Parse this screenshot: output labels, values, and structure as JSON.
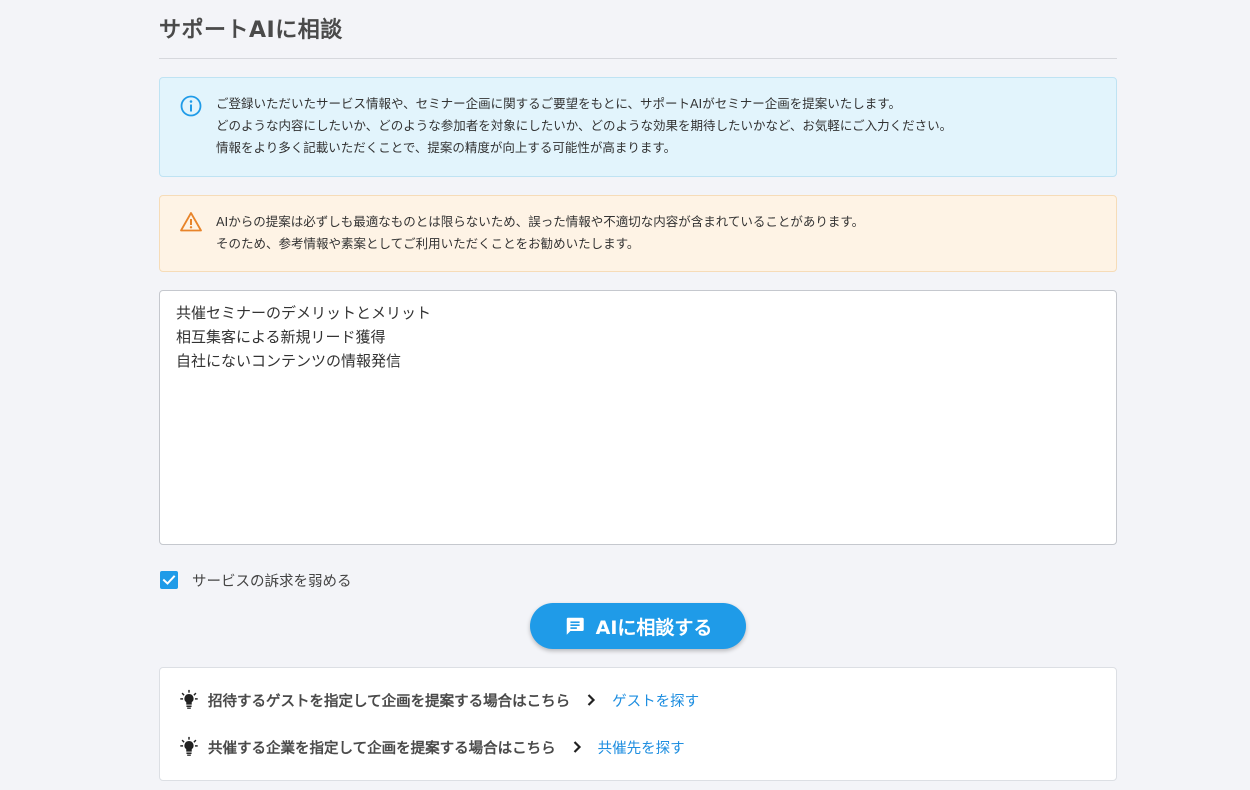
{
  "page": {
    "title": "サポートAIに相談"
  },
  "info_notice": {
    "icon": "info-icon",
    "color": "#1f9be8",
    "lines": [
      "ご登録いただいたサービス情報や、セミナー企画に関するご要望をもとに、サポートAIがセミナー企画を提案いたします。",
      "どのような内容にしたいか、どのような参加者を対象にしたいか、どのような効果を期待したいかなど、お気軽にご入力ください。",
      "情報をより多く記載いただくことで、提案の精度が向上する可能性が高まります。"
    ]
  },
  "warning_notice": {
    "icon": "warning-icon",
    "color": "#e8842a",
    "lines": [
      "AIからの提案は必ずしも最適なものとは限らないため、誤った情報や不適切な内容が含まれていることがあります。",
      "そのため、参考情報や素案としてご利用いただくことをお勧めいたします。"
    ]
  },
  "prompt": {
    "lines": [
      "共催セミナーのデメリットとメリット",
      "相互集客による新規リード獲得",
      "自社にないコンテンツの情報発信"
    ]
  },
  "options": {
    "weaken_appeal": {
      "label": "サービスの訴求を弱める",
      "checked": true
    }
  },
  "action": {
    "icon": "chat-icon",
    "label": "AIに相談する",
    "color": "#1f9be8"
  },
  "links": [
    {
      "icon": "lightbulb-icon",
      "text": "招待するゲストを指定して企画を提案する場合はこちら",
      "action": "ゲストを探す"
    },
    {
      "icon": "lightbulb-icon",
      "text": "共催する企業を指定して企画を提案する場合はこちら",
      "action": "共催先を探す"
    }
  ]
}
